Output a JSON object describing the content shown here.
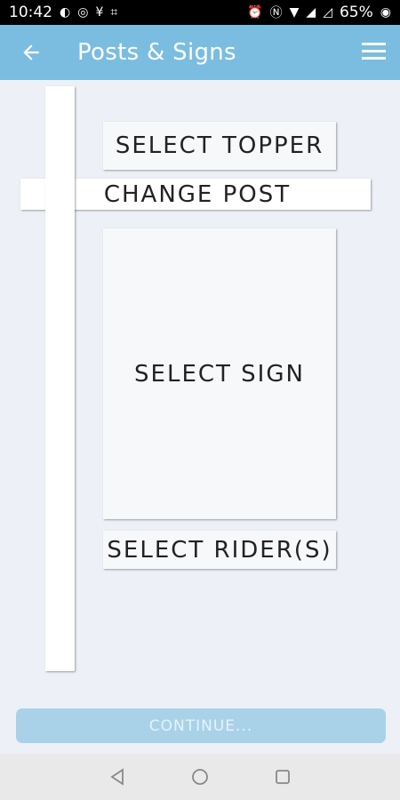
{
  "status_bar": {
    "time": "10:42",
    "battery": "65%",
    "left_icons": [
      "chrome-icon",
      "whatsapp-icon",
      "v-icon",
      "grid-icon"
    ],
    "right_icons": [
      "alarm-icon",
      "nfc-icon",
      "wifi-icon",
      "signal-icon",
      "battery-saver-icon"
    ]
  },
  "app_bar": {
    "title": "Posts & Signs",
    "colors": {
      "primary": "#7bbde1"
    }
  },
  "builder": {
    "topper_label": "SELECT TOPPER",
    "post_label": "CHANGE POST",
    "sign_label": "SELECT SIGN",
    "rider_label": "SELECT RIDER(S)"
  },
  "footer": {
    "continue_label": "CONTINUE..."
  },
  "nav_bar": {
    "buttons": [
      "back-triangle-icon",
      "home-circle-icon",
      "recents-square-icon"
    ]
  }
}
